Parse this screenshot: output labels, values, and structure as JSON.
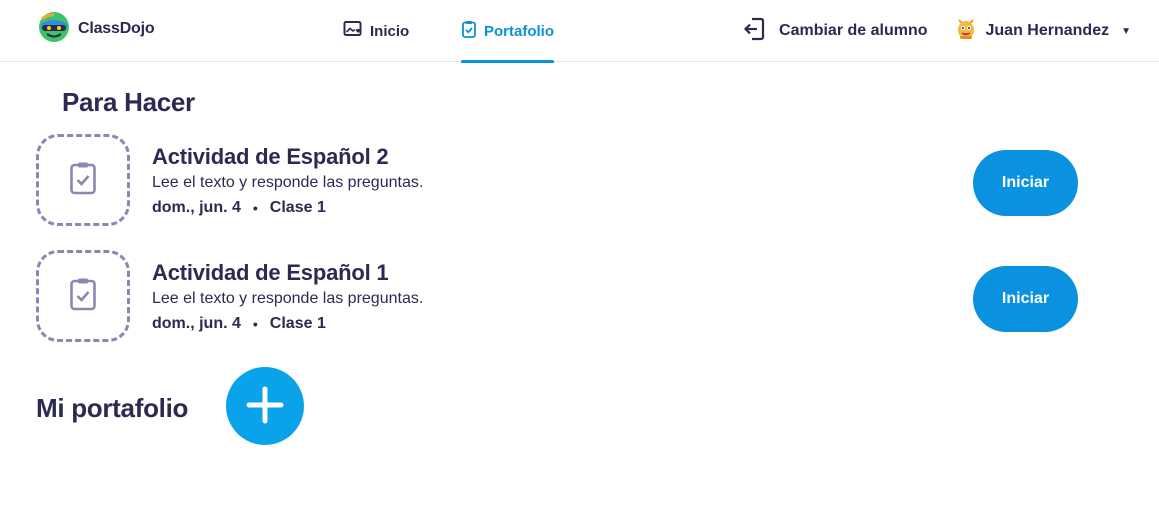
{
  "brand": {
    "name": "ClassDojo",
    "logo_icon": "classdojo-logo-icon"
  },
  "nav": {
    "tabs": [
      {
        "label": "Inicio",
        "icon": "photo-heart-icon",
        "active": false
      },
      {
        "label": "Portafolio",
        "icon": "clipboard-check-icon",
        "active": true
      }
    ]
  },
  "header": {
    "switch_student_label": "Cambiar de alumno",
    "switch_icon": "exit-door-icon",
    "user_name": "Juan Hernandez",
    "avatar_icon": "monster-avatar-icon"
  },
  "todo": {
    "title": "Para Hacer",
    "items": [
      {
        "title": "Actividad de Español 2",
        "description": "Lee el texto y responde las preguntas.",
        "date": "dom., jun. 4",
        "separator": "•",
        "class": "Clase 1",
        "button_label": "Iniciar"
      },
      {
        "title": "Actividad de Español 1",
        "description": "Lee el texto y responde las preguntas.",
        "date": "dom., jun. 4",
        "separator": "•",
        "class": "Clase 1",
        "button_label": "Iniciar"
      }
    ]
  },
  "portfolio": {
    "title": "Mi portafolio",
    "add_icon": "plus-icon"
  },
  "colors": {
    "accent": "#0a92d8",
    "button": "#0a92e0",
    "text": "#2c2a50",
    "dash": "#8a87b0"
  }
}
